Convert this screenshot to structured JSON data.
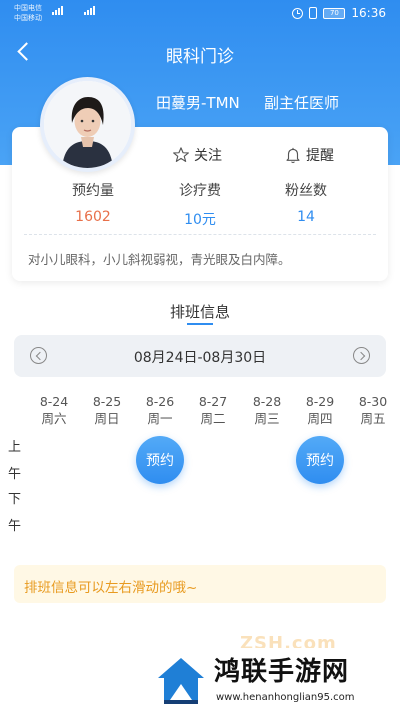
{
  "status": {
    "carrier1": "中国电信",
    "carrier2": "中国移动",
    "net1": "4G",
    "net2": "2G",
    "battery": "70",
    "time": "16:36"
  },
  "nav": {
    "title": "眼科门诊"
  },
  "doctor": {
    "name": "田蔓男-TMN",
    "rank": "副主任医师",
    "follow_label": "关注",
    "remind_label": "提醒",
    "stats": [
      {
        "label": "预约量",
        "value": "1602"
      },
      {
        "label": "诊疗费",
        "value": "10元"
      },
      {
        "label": "粉丝数",
        "value": "14"
      }
    ],
    "description": "对小儿眼科，小儿斜视弱视，青光眼及白内障。"
  },
  "schedule": {
    "title": "排班信息",
    "week_range": "08月24日-08月30日",
    "days": [
      {
        "date": "8-24",
        "weekday": "周六"
      },
      {
        "date": "8-25",
        "weekday": "周日"
      },
      {
        "date": "8-26",
        "weekday": "周一"
      },
      {
        "date": "8-27",
        "weekday": "周二"
      },
      {
        "date": "8-28",
        "weekday": "周三"
      },
      {
        "date": "8-29",
        "weekday": "周四"
      },
      {
        "date": "8-30",
        "weekday": "周五"
      }
    ],
    "periods": [
      "上午",
      "下午"
    ],
    "book_label": "预约",
    "tip": "排班信息可以左右滑动的哦~"
  },
  "watermark": {
    "title": "鸿联手游网",
    "url": "www.henanhonglian95.com",
    "faint": "ZSH.com"
  },
  "colors": {
    "primary": "#2f8df0",
    "accent_orange": "#e8704a",
    "tip_text": "#e89a1f",
    "tip_bg": "#fff8e5"
  }
}
